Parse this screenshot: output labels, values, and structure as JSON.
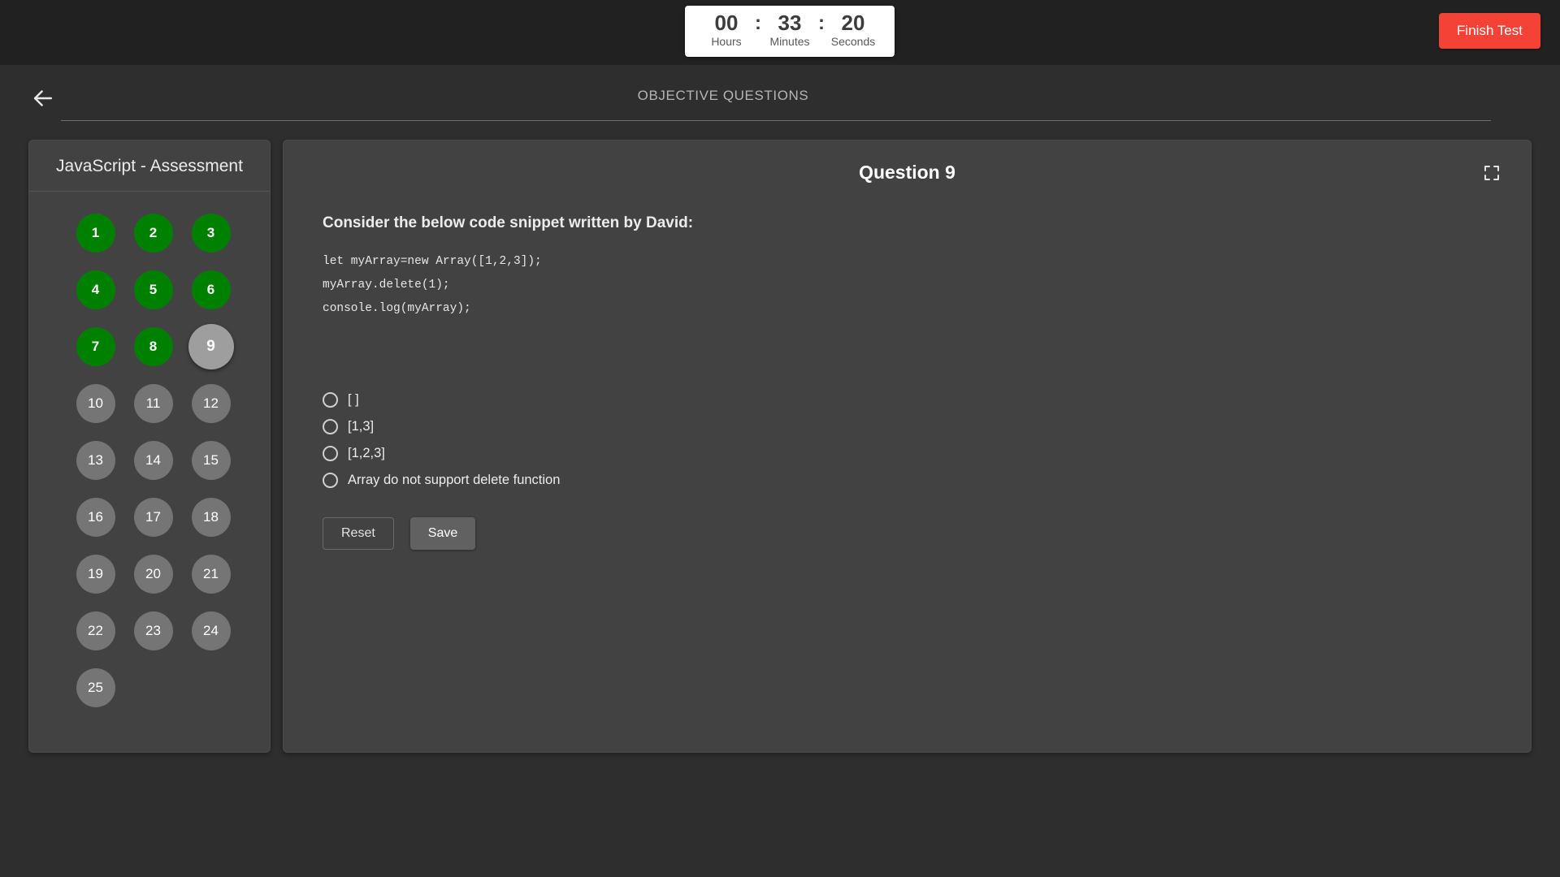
{
  "topbar": {
    "timer": {
      "hours": "00",
      "minutes": "33",
      "seconds": "20",
      "separator": ":",
      "hours_label": "Hours",
      "minutes_label": "Minutes",
      "seconds_label": "Seconds"
    },
    "finish_button": "Finish Test",
    "finish_button_color": "#f44336"
  },
  "header": {
    "back_icon": "arrow-left-icon",
    "title": "OBJECTIVE QUESTIONS"
  },
  "sidebar": {
    "title": "JavaScript - Assessment",
    "answered_color": "#008000",
    "pending_color": "#757575",
    "current_color": "#9e9e9e",
    "questions": [
      {
        "number": "1",
        "state": "answered"
      },
      {
        "number": "2",
        "state": "answered"
      },
      {
        "number": "3",
        "state": "answered"
      },
      {
        "number": "4",
        "state": "answered"
      },
      {
        "number": "5",
        "state": "answered"
      },
      {
        "number": "6",
        "state": "answered"
      },
      {
        "number": "7",
        "state": "answered"
      },
      {
        "number": "8",
        "state": "answered"
      },
      {
        "number": "9",
        "state": "current"
      },
      {
        "number": "10",
        "state": "pending"
      },
      {
        "number": "11",
        "state": "pending"
      },
      {
        "number": "12",
        "state": "pending"
      },
      {
        "number": "13",
        "state": "pending"
      },
      {
        "number": "14",
        "state": "pending"
      },
      {
        "number": "15",
        "state": "pending"
      },
      {
        "number": "16",
        "state": "pending"
      },
      {
        "number": "17",
        "state": "pending"
      },
      {
        "number": "18",
        "state": "pending"
      },
      {
        "number": "19",
        "state": "pending"
      },
      {
        "number": "20",
        "state": "pending"
      },
      {
        "number": "21",
        "state": "pending"
      },
      {
        "number": "22",
        "state": "pending"
      },
      {
        "number": "23",
        "state": "pending"
      },
      {
        "number": "24",
        "state": "pending"
      },
      {
        "number": "25",
        "state": "pending"
      }
    ]
  },
  "question": {
    "title": "Question 9",
    "expand_icon": "fullscreen-icon",
    "prompt": "Consider the below code snippet written by David:",
    "code": "let myArray=new Array([1,2,3]);\nmyArray.delete(1);\nconsole.log(myArray);",
    "options": [
      {
        "label": "[ ]",
        "selected": false
      },
      {
        "label": "[1,3]",
        "selected": false
      },
      {
        "label": "[1,2,3]",
        "selected": false
      },
      {
        "label": "Array do not support delete function",
        "selected": false
      }
    ],
    "reset_button": "Reset",
    "save_button": "Save"
  }
}
